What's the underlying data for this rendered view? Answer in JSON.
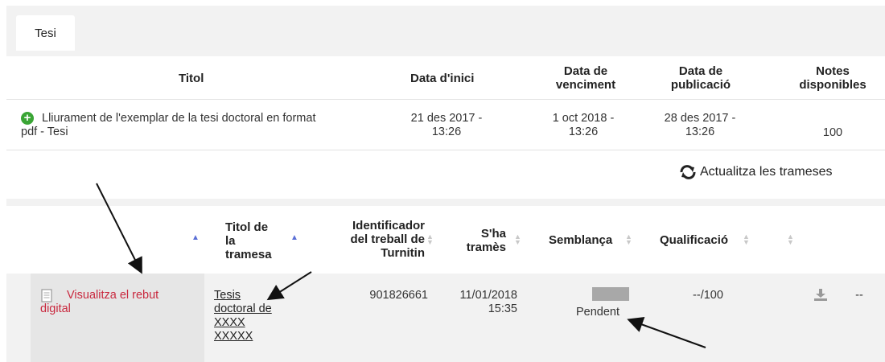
{
  "tab": {
    "label": "Tesi"
  },
  "assignments_table": {
    "headers": {
      "title": "Titol",
      "start_date": "Data d'inici",
      "due_date_l1": "Data de",
      "due_date_l2": "venciment",
      "pub_date_l1": "Data de",
      "pub_date_l2": "publicació",
      "grades_l1": "Notes",
      "grades_l2": "disponibles"
    },
    "row": {
      "title_l1": "Lliurament de l'exemplar de la tesi doctoral en format",
      "title_l2": "pdf - Tesi",
      "start_l1": "21 des 2017 -",
      "start_l2": "13:26",
      "due_l1": "1 oct 2018 -",
      "due_l2": "13:26",
      "pub_l1": "28 des 2017 -",
      "pub_l2": "13:26",
      "grades": "100"
    }
  },
  "refresh": {
    "label": "Actualitza les trameses"
  },
  "submissions_table": {
    "headers": {
      "title_l1": "Titol de",
      "title_l2": "la",
      "title_l3": "tramesa",
      "ident_l1": "Identificador",
      "ident_l2": "del treball de",
      "ident_l3": "Turnitin",
      "sent_l1": "S'ha",
      "sent_l2": "tramès",
      "similarity": "Semblança",
      "grade": "Qualificació"
    },
    "row": {
      "receipt_l1": "Visualitza el rebut",
      "receipt_l2": "digital",
      "title_l1": "Tesis",
      "title_l2": "doctoral de",
      "title_l3": "XXXX",
      "title_l4": "XXXXX",
      "ident": "901826661",
      "sent_l1": "11/01/2018",
      "sent_l2": "15:35",
      "similarity": "Pendent",
      "grade": "--/100",
      "extra": "--"
    }
  },
  "colors": {
    "link_red": "#c9283e",
    "plus_green": "#3aa535",
    "sort_blue": "#5b6fd6"
  },
  "icons": [
    "plus-circle-icon",
    "refresh-icon",
    "document-icon",
    "download-icon",
    "sort-icon"
  ]
}
